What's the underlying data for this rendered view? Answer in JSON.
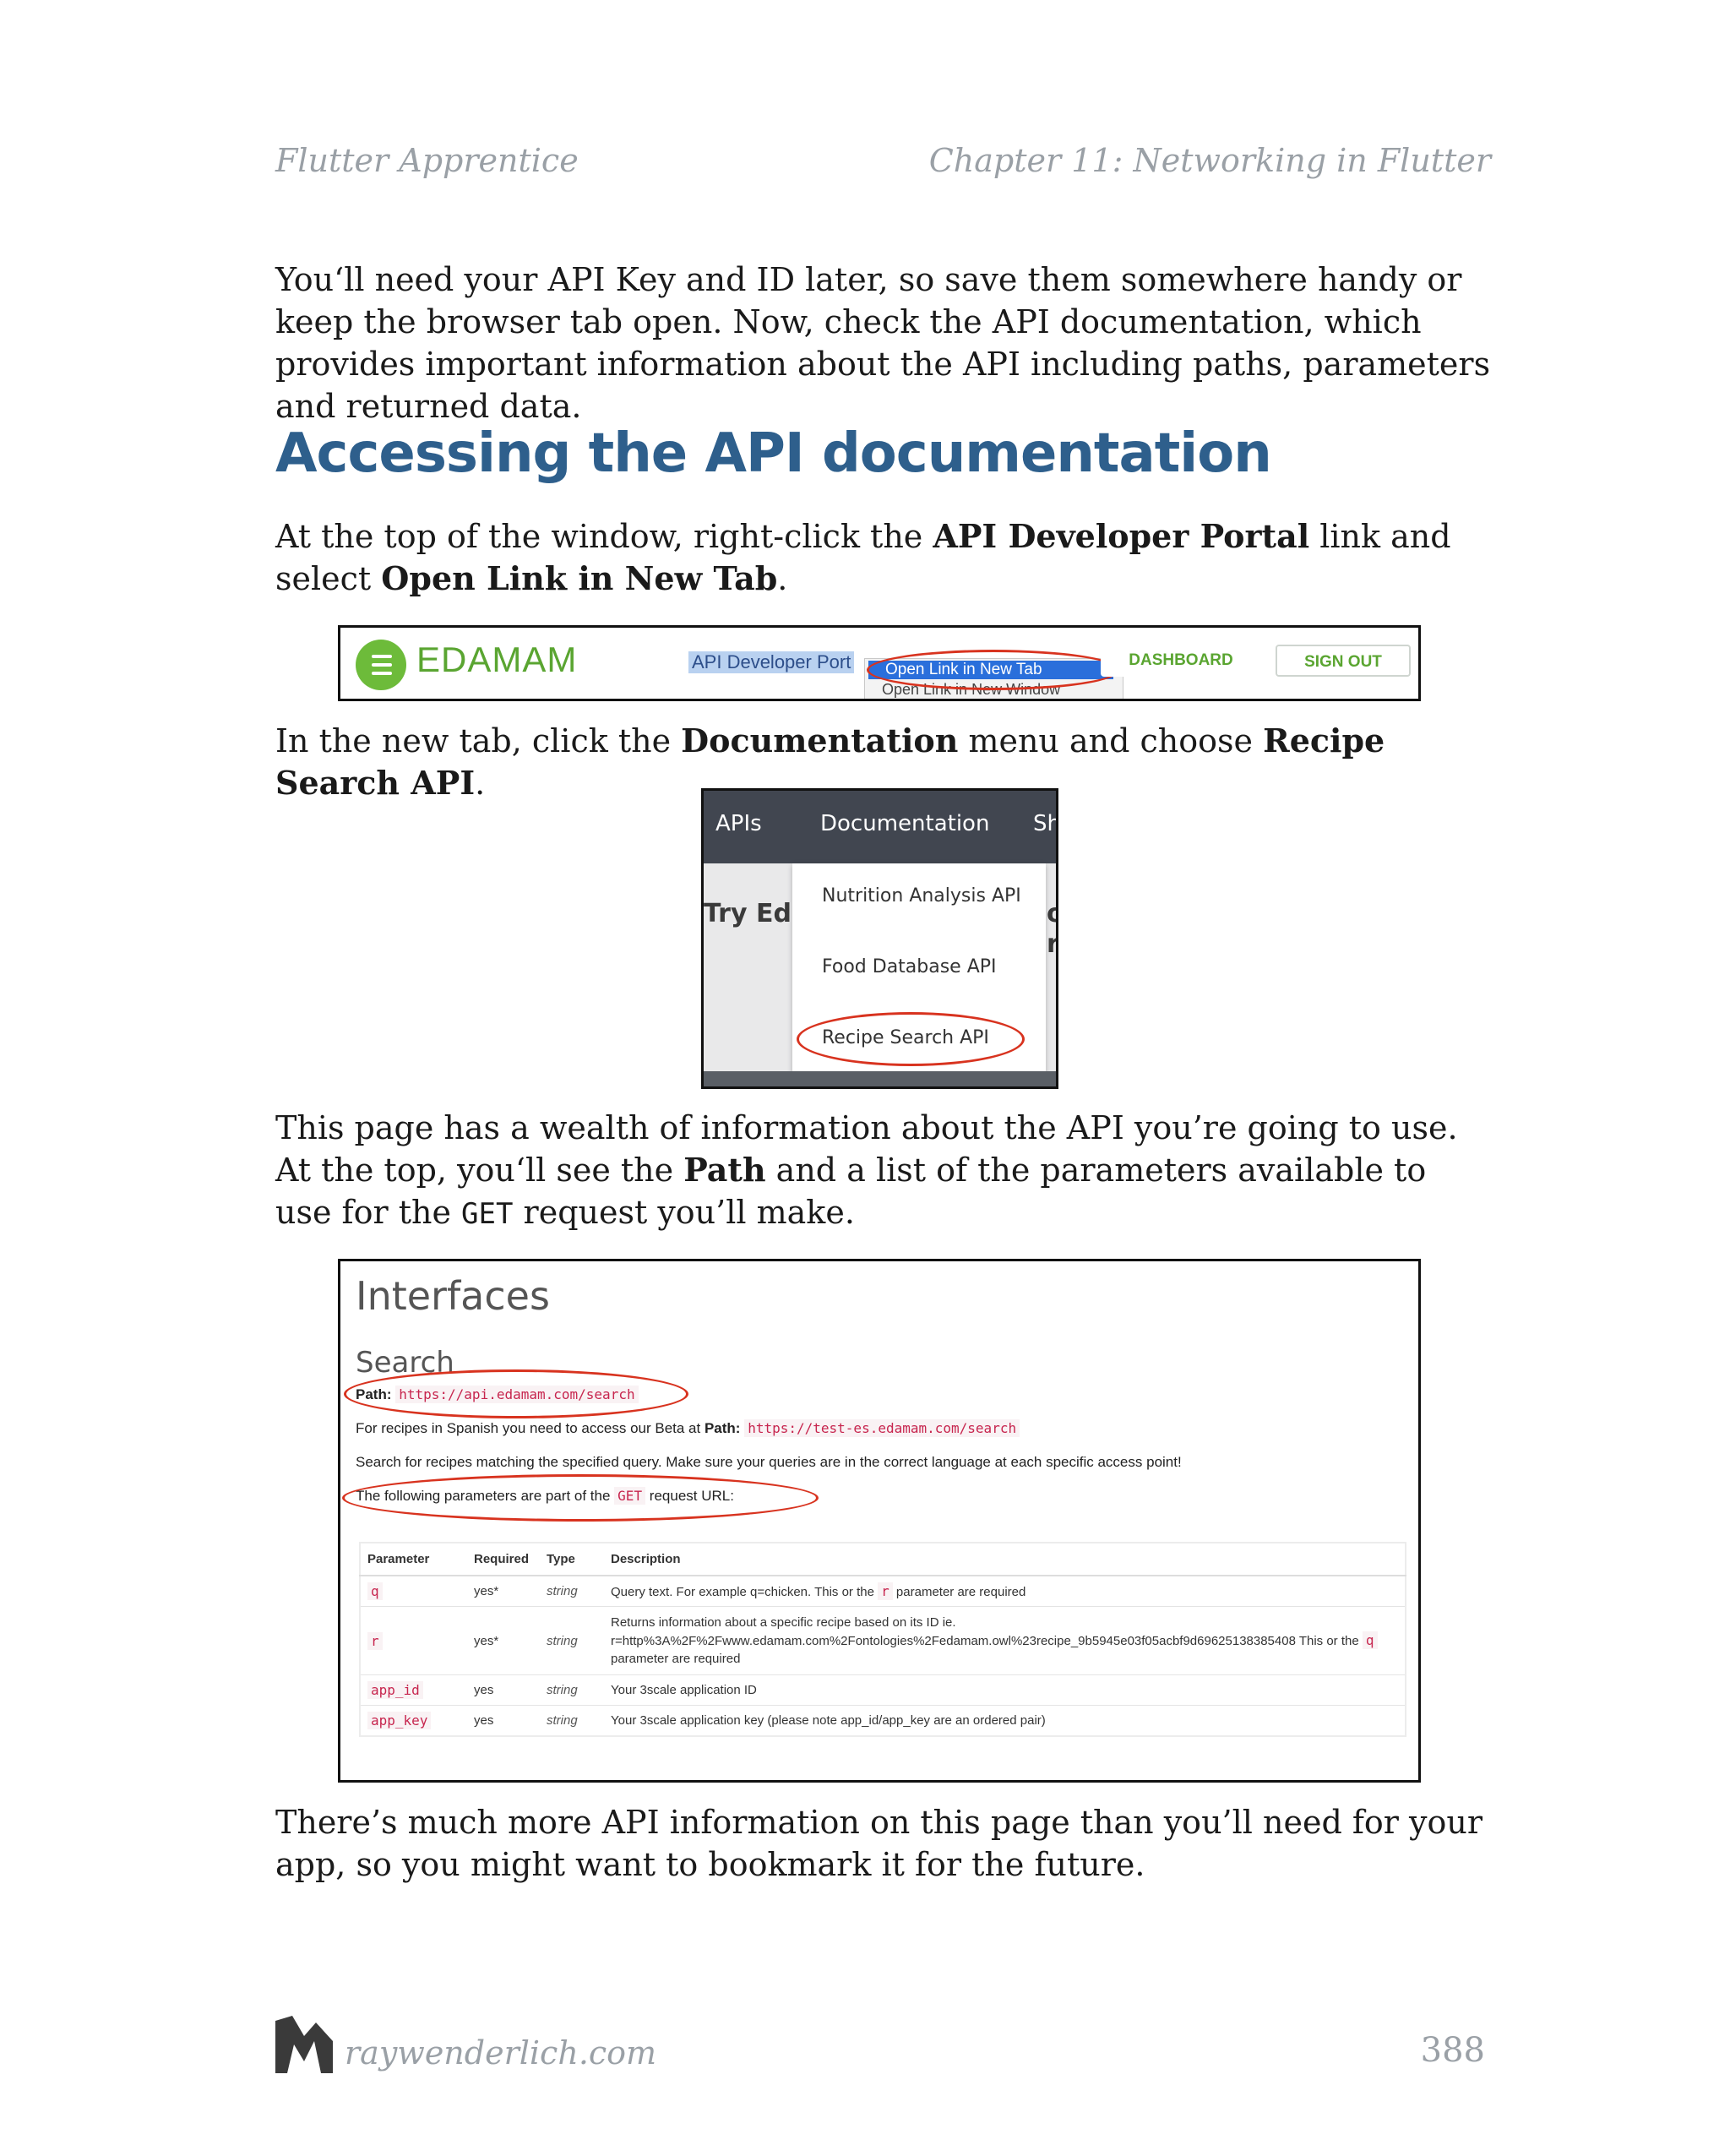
{
  "header": {
    "book_title": "Flutter Apprentice",
    "chapter_title": "Chapter 11: Networking in Flutter"
  },
  "intro_paragraph": "You‘ll need your API Key and ID later, so save them somewhere handy or keep the browser tab open. Now, check the API documentation, which provides important information about the API including paths, parameters and returned data.",
  "section_heading": "Accessing the API documentation",
  "step1": {
    "text1": "At the top of the window, right-click the ",
    "bold1": "API Developer Portal",
    "text2": " link and select ",
    "bold2": "Open Link in New Tab",
    "text3": "."
  },
  "screenshot1": {
    "logo_text": "EDAMAM",
    "portal_link": "API Developer Port",
    "context_menu": [
      "Open Link in New Tab",
      "Open Link in New Window"
    ],
    "dashboard_button": "DASHBOARD",
    "signout_button": "SIGN OUT"
  },
  "step2": {
    "text1": "In the new tab, click the ",
    "bold1": "Documentation",
    "text2": " menu and choose ",
    "bold2": "Recipe Search API",
    "text3": "."
  },
  "screenshot2": {
    "nav": [
      "APIs",
      "Documentation",
      "Sh"
    ],
    "background_text": "Try Edar",
    "background_right": [
      "o",
      "r"
    ],
    "dropdown": [
      "Nutrition Analysis API",
      "Food Database API",
      "Recipe Search API"
    ]
  },
  "step3": {
    "text1": "This page has a wealth of information about the API you’re going to use. At the top, you‘ll see the ",
    "bold1": "Path",
    "text2": " and a list of the parameters available to use for the ",
    "code1": "GET",
    "text3": " request you’ll make."
  },
  "screenshot3": {
    "title": "Interfaces",
    "subtitle": "Search",
    "path_label": "Path:",
    "path_url": "https://api.edamam.com/search",
    "spanish_text": "For recipes in Spanish you need to access our Beta at ",
    "spanish_path_label": "Path:",
    "spanish_url": "https://test-es.edamam.com/search",
    "search_text": "Search for recipes matching the specified query. Make sure your queries are in the correct language at each specific access point!",
    "params_text_1": "The following parameters are part of the ",
    "params_code": "GET",
    "params_text_2": " request URL:",
    "table_headers": [
      "Parameter",
      "Required",
      "Type",
      "Description"
    ],
    "rows": [
      {
        "param": "q",
        "required": "yes*",
        "type": "string",
        "desc_1": "Query text. For example q=chicken. This or the ",
        "desc_code": "r",
        "desc_2": " parameter are required",
        "desc_pre": ""
      },
      {
        "param": "r",
        "required": "yes*",
        "type": "string",
        "desc_pre": "Returns information about a specific recipe based on its ID ie. r=http%3A%2F%2Fwww.edamam.com%2Fontologies%2Fedamam.owl%23recipe_9b5945e03f05acbf9d69625138385408 This or the ",
        "desc_code": "q",
        "desc_2": " parameter are required",
        "desc_1": ""
      },
      {
        "param": "app_id",
        "required": "yes",
        "type": "string",
        "desc_1": "Your 3scale application ID",
        "desc_code": "",
        "desc_2": "",
        "desc_pre": ""
      },
      {
        "param": "app_key",
        "required": "yes",
        "type": "string",
        "desc_1": "Your 3scale application key (please note app_id/app_key are an ordered pair)",
        "desc_code": "",
        "desc_2": "",
        "desc_pre": ""
      }
    ]
  },
  "closing_paragraph": "There’s much more API information on this page than you’ll need for your app, so you might want to bookmark it for the future.",
  "footer": {
    "site": "raywenderlich.com",
    "page_number": "388"
  },
  "colors": {
    "heading": "#2e5f8c",
    "edamam_green": "#5aa531",
    "annotation_red": "#d8331f",
    "code_red": "#c7254e"
  }
}
